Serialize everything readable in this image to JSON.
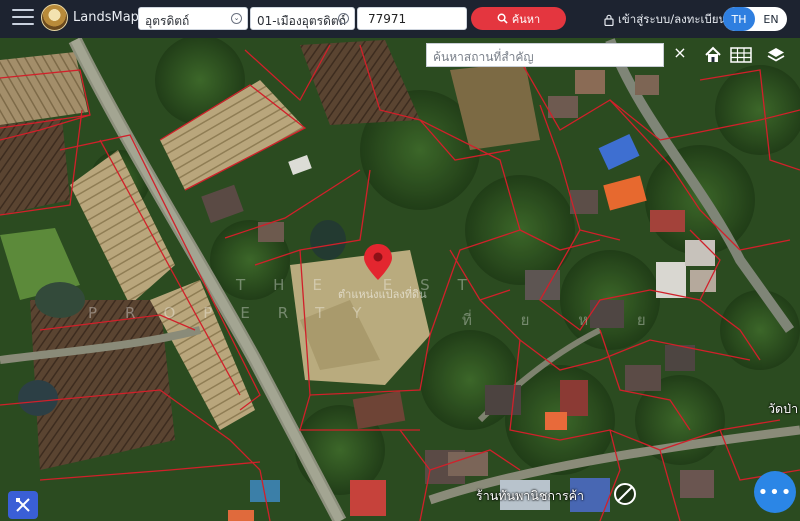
{
  "header": {
    "brand": "LandsMaps",
    "province": "อุตรดิตถ์",
    "district": "01-เมืองอุตรดิตถ์",
    "parcel_number": "77971",
    "search_label": "ค้นหา",
    "login_label": "เข้าสู่ระบบ/ลงทะเบียน",
    "lang_th": "TH",
    "lang_en": "EN",
    "active_lang": "TH"
  },
  "map": {
    "place_search_placeholder": "ค้นหาสถานที่สำคัญ",
    "close_symbol": "×",
    "controls": [
      "home-icon",
      "grid-icon",
      "layers-icon"
    ],
    "marker_label": "ตำแหน่งแปลงที่ดิน",
    "watermark_line1": "THE EST",
    "watermark_line2": "PROPERTY",
    "watermark_thai": "ที่ ย ห ย",
    "place_labels": {
      "shop": "ร้านทันพานิชการค้า",
      "temple": "วัดป่า"
    },
    "colors": {
      "boundary": "#d1202a",
      "marker": "#e3262f",
      "topbar": "#1d2330",
      "accent": "#2f7fe0"
    }
  },
  "footer": {
    "tools_icon": "tools-icon",
    "more_icon": "more-icon",
    "more_symbol": "•••"
  }
}
